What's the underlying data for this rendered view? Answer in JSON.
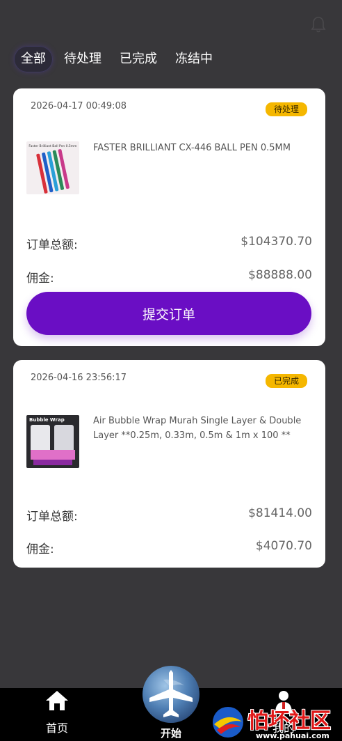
{
  "tabs": [
    {
      "label": "全部",
      "active": true
    },
    {
      "label": "待处理",
      "active": false
    },
    {
      "label": "已完成",
      "active": false
    },
    {
      "label": "冻结中",
      "active": false
    }
  ],
  "orders": [
    {
      "date": "2026-04-17 00:49:08",
      "status": "待处理",
      "product": "FASTER BRILLIANT CX-446 BALL PEN 0.5MM",
      "thumb_text": "Faster Brilliant Ball Pen 0.5mm",
      "total_label": "订单总额:",
      "total": "$104370.70",
      "commission_label": "佣金:",
      "commission": "$88888.00",
      "submit_label": "提交订单"
    },
    {
      "date": "2026-04-16 23:56:17",
      "status": "已完成",
      "product": "Air Bubble Wrap Murah Single Layer & Double Layer **0.25m, 0.33m, 0.5m & 1m x 100 **",
      "thumb_text": "Bubble Wrap",
      "total_label": "订单总额:",
      "total": "$81414.00",
      "commission_label": "佣金:",
      "commission": "$4070.70"
    }
  ],
  "nav": {
    "home": "首页",
    "start": "开始",
    "me": "我的"
  },
  "watermark": {
    "text": "怕坏社区",
    "url": "www.pahuai.com"
  },
  "colors": {
    "background": "#38373a",
    "accent": "#6a0ec4",
    "badge": "#f5b700"
  },
  "icons": [
    "bell-icon",
    "home-icon",
    "airplane-icon",
    "user-icon"
  ]
}
